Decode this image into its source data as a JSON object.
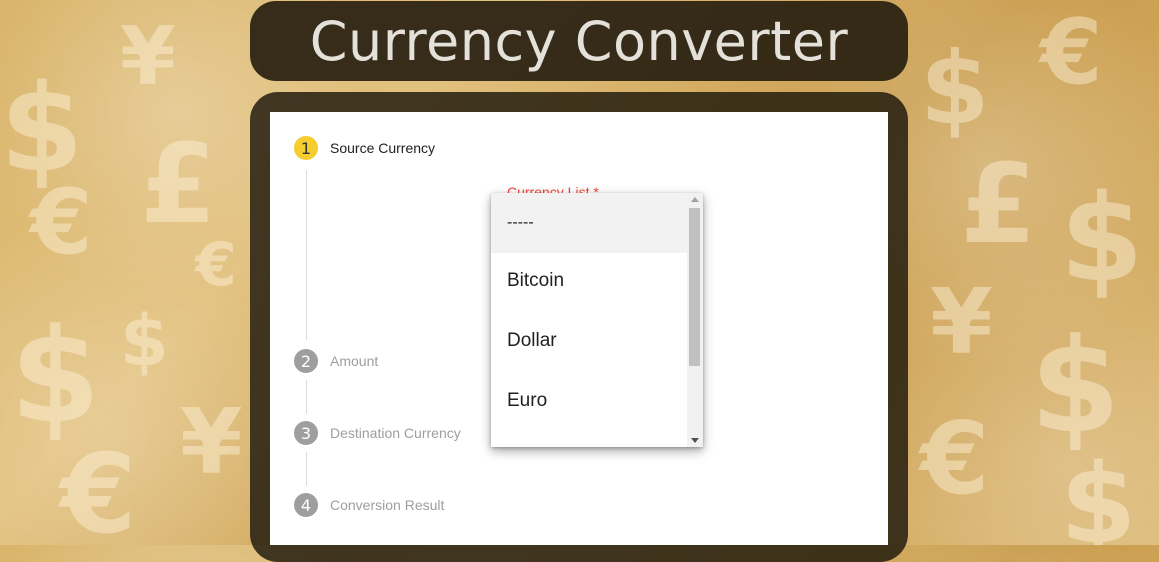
{
  "app": {
    "title": "Currency Converter"
  },
  "stepper": {
    "steps": [
      {
        "number": "1",
        "label": "Source Currency",
        "state": "active"
      },
      {
        "number": "2",
        "label": "Amount",
        "state": "inactive"
      },
      {
        "number": "3",
        "label": "Destination Currency",
        "state": "inactive"
      },
      {
        "number": "4",
        "label": "Conversion Result",
        "state": "inactive"
      }
    ]
  },
  "currency_select": {
    "label": "Currency List *",
    "options": [
      "-----",
      "Bitcoin",
      "Dollar",
      "Euro"
    ],
    "highlighted_index": 0
  },
  "colors": {
    "active_step": "#f5cd2f",
    "inactive_step": "#9e9e9e",
    "required_label": "#f44336",
    "header_bg": "#231c0e"
  }
}
